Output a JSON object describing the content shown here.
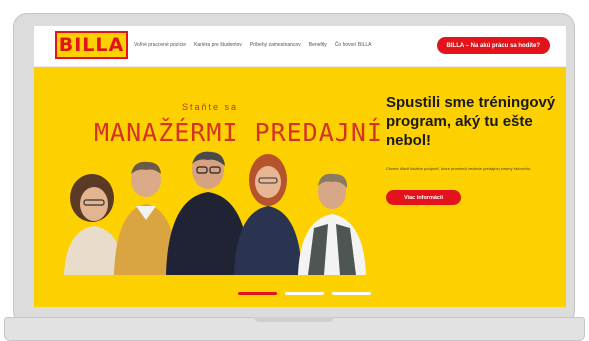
{
  "header": {
    "logo_text": "BILLA",
    "nav": [
      "Voľné pracovné pozície",
      "Kariéra pre študentov",
      "Príbehy zamestnancov",
      "Benefity",
      "Čo hovorí BILLA"
    ],
    "cta": "BILLA – Na akú prácu sa hodíte?"
  },
  "hero": {
    "subtitle": "Staňte sa",
    "title": "MANAŽÉRMI PREDAJNÍ",
    "headline": "Spustili sme tréningový program, aký tu ešte nebol!",
    "text": "Chcete hľadť lokálne podporiť, ktoré prostredí vedenie predajnej zmeny ťažového.",
    "cta": "Viac informácií"
  },
  "carousel": {
    "slides": 3,
    "active": 1
  },
  "colors": {
    "brand_yellow": "#fdd000",
    "brand_red": "#e3131b"
  }
}
